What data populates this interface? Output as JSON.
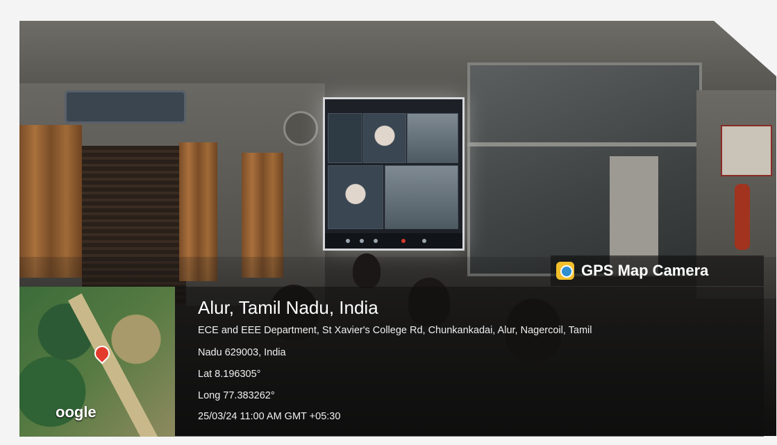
{
  "overlay": {
    "brand": "GPS Map Camera",
    "brand_icon": "gps-camera-icon",
    "location_title": "Alur, Tamil Nadu, India",
    "address_line_1": "ECE and EEE Department, St Xavier's College Rd, Chunkankadai, Alur, Nagercoil, Tamil",
    "address_line_2": "Nadu 629003, India",
    "latitude": "Lat 8.196305°",
    "longitude": "Long 77.383262°",
    "timestamp": "25/03/24 11:00 AM GMT +05:30",
    "map_watermark": "oogle"
  },
  "colors": {
    "pin": "#e33b2e",
    "overlay_bg": "#0f0f0f",
    "text": "#ffffff"
  }
}
